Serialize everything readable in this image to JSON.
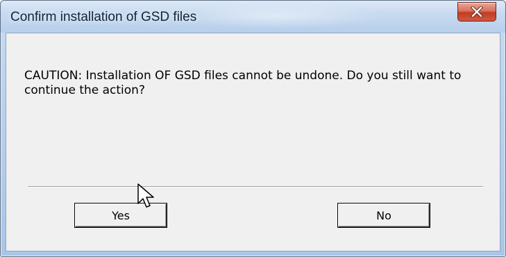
{
  "window": {
    "title": "Confirm installation of GSD files"
  },
  "dialog": {
    "message": "CAUTION: Installation OF GSD files cannot be undone. Do you still want to continue the action?"
  },
  "buttons": {
    "yes_label": "Yes",
    "no_label": "No"
  },
  "icons": {
    "close": "close-icon",
    "cursor": "mouse-pointer-icon"
  },
  "colors": {
    "client_background": "#f0f0f0",
    "close_button": "#c33c22",
    "titlebar": "#c7daf0"
  }
}
